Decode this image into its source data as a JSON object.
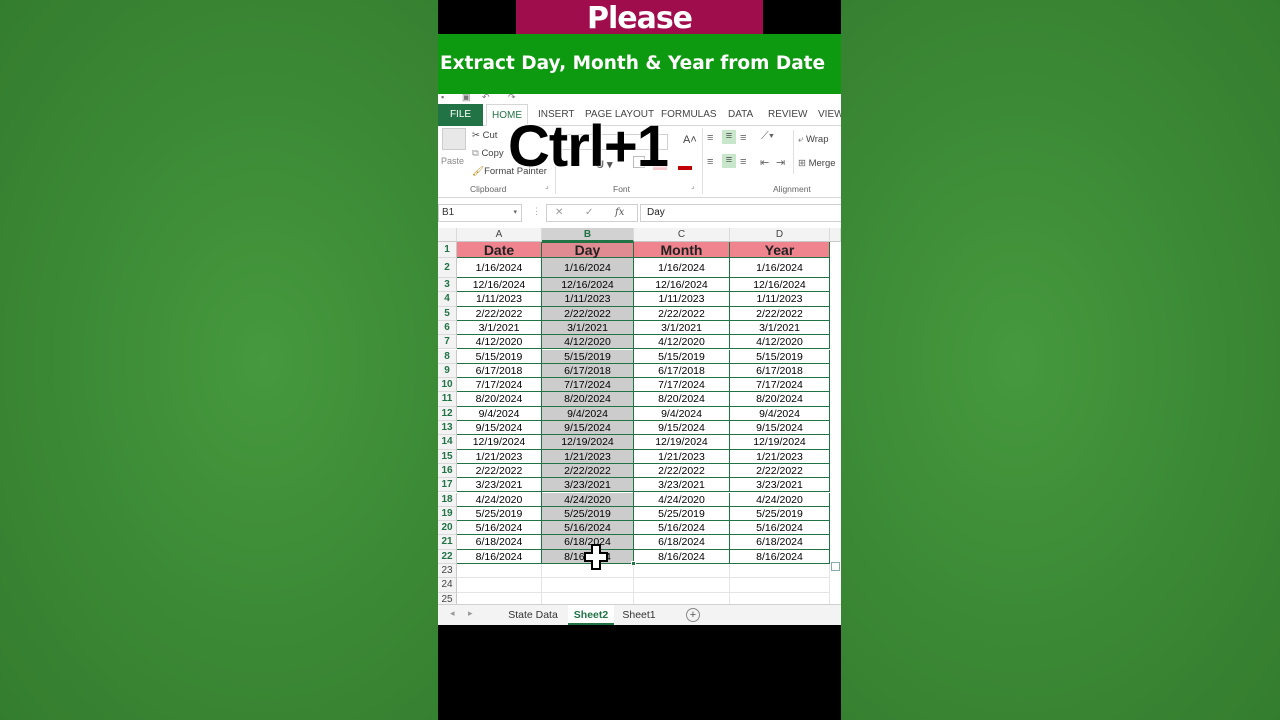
{
  "overlay": {
    "subscribe": "Please Subscribe",
    "title": "Extract Day, Month & Year from Date",
    "shortcut": "Ctrl+1"
  },
  "ribbon_tabs": [
    "FILE",
    "HOME",
    "INSERT",
    "PAGE LAYOUT",
    "FORMULAS",
    "DATA",
    "REVIEW",
    "VIEW"
  ],
  "ribbon": {
    "paste": "Paste",
    "cut": "Cut",
    "copy": "Copy",
    "format_painter": "Format Painter",
    "clipboard": "Clipboard",
    "font": "Font",
    "alignment": "Alignment",
    "wrap": "Wrap",
    "merge": "Merge"
  },
  "formula_bar": {
    "name_box": "B1",
    "fx": "fx",
    "content": "Day"
  },
  "columns": [
    "A",
    "B",
    "C",
    "D"
  ],
  "headers": [
    "Date",
    "Day",
    "Month",
    "Year"
  ],
  "rows": [
    "1/16/2024",
    "12/16/2024",
    "1/11/2023",
    "2/22/2022",
    "3/1/2021",
    "4/12/2020",
    "5/15/2019",
    "6/17/2018",
    "7/17/2024",
    "8/20/2024",
    "9/4/2024",
    "9/15/2024",
    "12/19/2024",
    "1/21/2023",
    "2/22/2022",
    "3/23/2021",
    "4/24/2020",
    "5/25/2019",
    "5/16/2024",
    "6/18/2024",
    "8/16/2024"
  ],
  "row_numbers": [
    "1",
    "2",
    "3",
    "4",
    "5",
    "6",
    "7",
    "8",
    "9",
    "10",
    "11",
    "12",
    "13",
    "14",
    "15",
    "16",
    "17",
    "18",
    "19",
    "20",
    "21",
    "22",
    "23",
    "24",
    "25"
  ],
  "sheet_tabs": [
    "State Data",
    "Sheet2",
    "Sheet1"
  ],
  "active_sheet": "Sheet2",
  "colors": {
    "excel_green": "#217346",
    "header_fill": "#f0848e",
    "selection_fill": "#cccccc",
    "subscribe_bg": "#a00d4d",
    "title_bg": "#0e9a10"
  }
}
